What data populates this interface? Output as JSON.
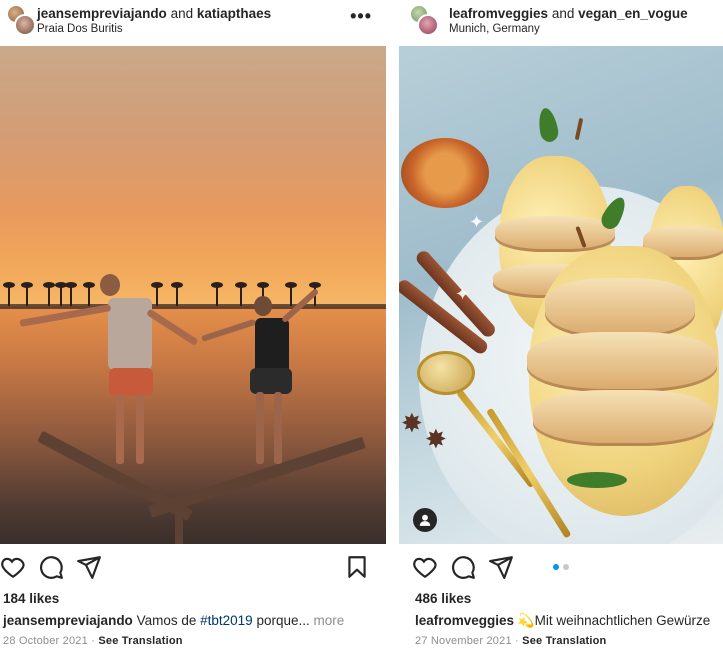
{
  "posts": [
    {
      "users": [
        "jeansempreviajando",
        "katiapthaes"
      ],
      "connector": "and",
      "location": "Praia Dos Buritis",
      "more_icon_text": "•••",
      "likes": "184 likes",
      "caption_user": "jeansempreviajando",
      "caption_text_before": "Vamos de",
      "caption_hashtag": "#tbt2019",
      "caption_text_after": "porque...",
      "more_label": "more",
      "date": "28 October 2021",
      "separator": "·",
      "see_translation": "See Translation"
    },
    {
      "users": [
        "leafromveggies",
        "vegan_en_vogue"
      ],
      "connector": "and",
      "location": "Munich, Germany",
      "likes": "486 likes",
      "caption_user": "leafromveggies",
      "caption_text": "💫Mit weihnachtlichen Gewürze",
      "date": "27 November 2021",
      "separator": "·",
      "see_translation": "See Translation",
      "carousel_active_index": 0,
      "carousel_count": 2
    }
  ],
  "icons": [
    "heart-icon",
    "comment-icon",
    "share-icon",
    "bookmark-icon",
    "user-tag-icon",
    "more-options-icon"
  ],
  "colors": {
    "link": "#00376b",
    "muted": "#8e8e8e",
    "active_dot": "#0095f6"
  }
}
